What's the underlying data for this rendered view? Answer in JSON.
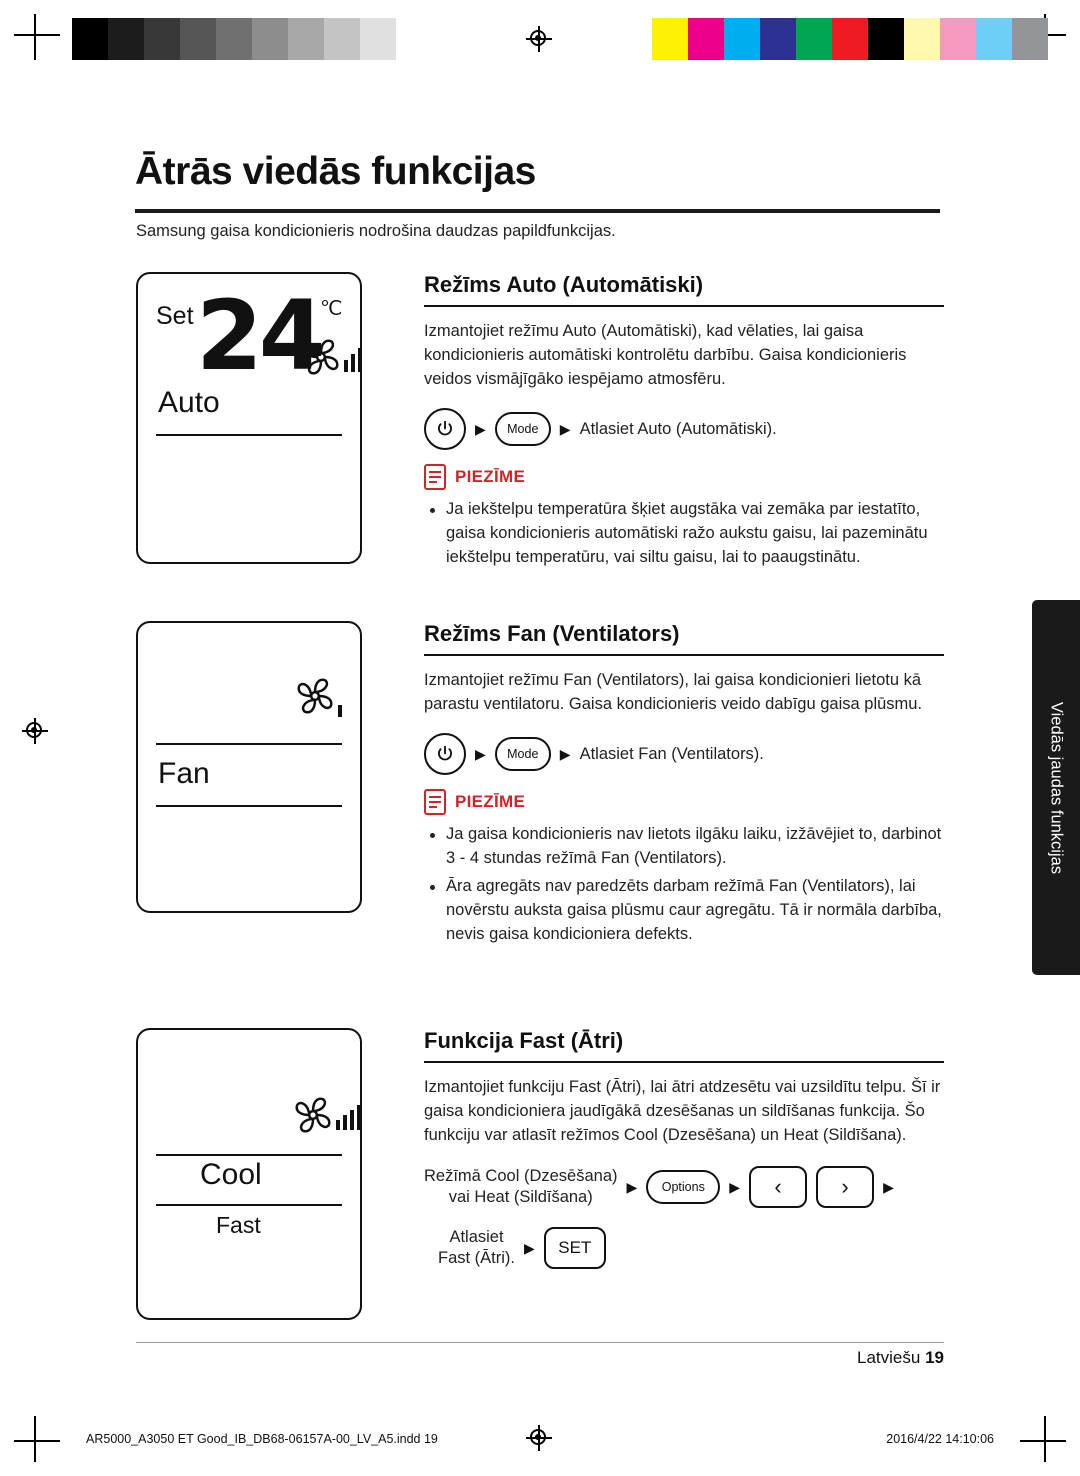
{
  "document": {
    "title": "Ātrās viedās funkcijas",
    "intro": "Samsung gaisa kondicionieris nodrošina daudzas papildfunkcijas.",
    "footer_lang": "Latviešu",
    "footer_page": "19",
    "imprint": "AR5000_A3050 ET Good_IB_DB68-06157A-00_LV_A5.indd   19",
    "stamp": "2016/4/22   14:10:06",
    "side_tab": "Viedās jaudas funkcijas"
  },
  "panels": [
    {
      "name": "auto",
      "set_label": "Set",
      "temperature": "24",
      "degree": "℃",
      "mode": "Auto",
      "sub": ""
    },
    {
      "name": "fan",
      "set_label": "",
      "temperature": "",
      "degree": "",
      "mode": "Fan",
      "sub": ""
    },
    {
      "name": "cool",
      "set_label": "",
      "temperature": "",
      "degree": "",
      "mode": "Cool",
      "sub": "Fast"
    }
  ],
  "sections": [
    {
      "heading": "Režīms Auto (Automātiski)",
      "body": "Izmantojiet režīmu Auto (Automātiski), kad vēlaties, lai gaisa kondicionieris automātiski kontrolētu darbību. Gaisa kondicionieris veidos vismājīgāko iespējamo atmosfēru.",
      "step_button_power": "power-icon",
      "step_button_mode": "Mode",
      "step_text": "Atlasiet Auto (Automātiski).",
      "note_label": "PIEZĪME",
      "notes": [
        "Ja iekštelpu temperatūra šķiet augstāka vai zemāka par iestatīto, gaisa kondicionieris automātiski ražo aukstu gaisu, lai pazeminātu iekštelpu temperatūru, vai siltu gaisu, lai to paaugstinātu."
      ]
    },
    {
      "heading": "Režīms Fan (Ventilators)",
      "body": "Izmantojiet režīmu Fan (Ventilators), lai gaisa kondicionieri lietotu kā parastu ventilatoru. Gaisa kondicionieris veido dabīgu gaisa plūsmu.",
      "step_button_power": "power-icon",
      "step_button_mode": "Mode",
      "step_text": "Atlasiet Fan (Ventilators).",
      "note_label": "PIEZĪME",
      "notes": [
        "Ja gaisa kondicionieris nav lietots ilgāku laiku, izžāvējiet to, darbinot 3 - 4 stundas režīmā Fan (Ventilators).",
        "Āra agregāts nav paredzēts darbam režīmā Fan (Ventilators), lai novērstu auksta gaisa plūsmu caur agregātu. Tā ir normāla darbība, nevis gaisa kondicioniera defekts."
      ]
    },
    {
      "heading": "Funkcija Fast (Ātri)",
      "body": "Izmantojiet funkciju Fast (Ātri), lai ātri atdzesētu vai uzsildītu telpu. Šī ir gaisa kondicioniera jaudīgākā dzesēšanas un sildīšanas funkcija. Šo funkciju var atlasīt režīmos Cool (Dzesēšana) un Heat (Sildīšana).",
      "fast_step1_text_line1": "Režīmā Cool (Dzesēšana)",
      "fast_step1_text_line2": "vai Heat (Sildīšana)",
      "fast_options_label": "Options",
      "fast_arrow_left": "‹",
      "fast_arrow_right": "›",
      "fast_step2_text_line1": "Atlasiet",
      "fast_step2_text_line2": "Fast (Ātri).",
      "fast_set_label": "SET"
    }
  ],
  "colors": {
    "note_red": "#d2232a",
    "ink": "#111111",
    "tab_bg": "#1a1a1a"
  },
  "strips": {
    "gray": [
      "#000000",
      "#1c1c1c",
      "#383838",
      "#555555",
      "#707070",
      "#8c8c8c",
      "#a8a8a8",
      "#c4c4c4",
      "#e0e0e0",
      "#ffffff"
    ],
    "color": [
      "#fff200",
      "#ec008c",
      "#00aeef",
      "#2e3192",
      "#00a651",
      "#ed1c24",
      "#000000",
      "#fff9ae",
      "#f49ac1",
      "#6dcff6",
      "#939598"
    ]
  }
}
